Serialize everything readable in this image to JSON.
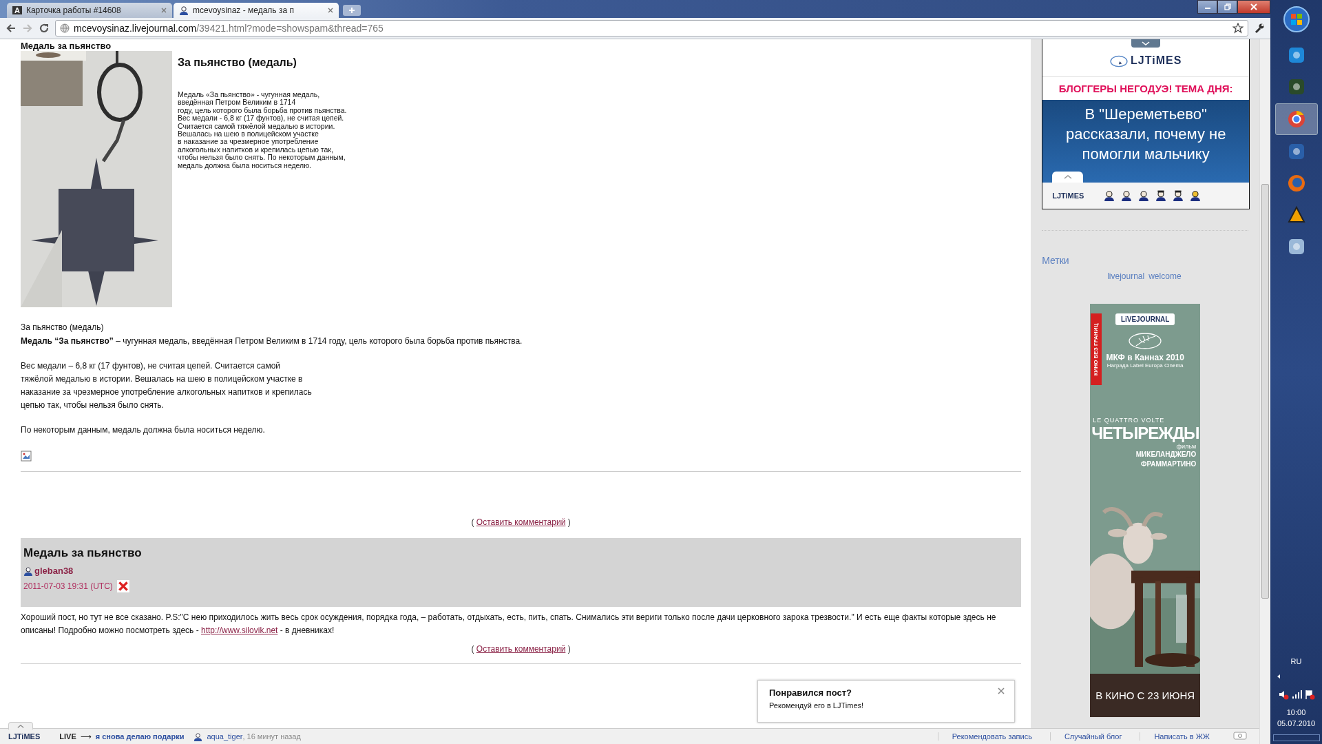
{
  "browser": {
    "tabs": [
      {
        "title": "Карточка работы #14608",
        "icon_letter": "A",
        "selected": false
      },
      {
        "title": "mcevoysinaz - медаль за п",
        "selected": true
      }
    ],
    "url": {
      "host": "mcevoysinaz.livejournal.com",
      "path": "/39421.html?mode=showspam&thread=765"
    }
  },
  "post": {
    "title": "Медаль за пьянство",
    "figure": {
      "heading": "За пьянство (медаль)",
      "lines": [
        "Медаль «За пьянство» - чугунная медаль,",
        "введённая Петром Великим в 1714",
        "году, цель которого была борьба против пьянства.",
        "Вес медали - 6,8 кг (17 фунтов), не считая цепей.",
        "Считается самой тяжёлой медалью в истории.",
        "Вешалась на шею в полицейском участке",
        "в наказание за чрезмерное употребление",
        "алкогольных напитков и крепилась цепью так,",
        "чтобы нельзя было снять. По некоторым данным,",
        "медаль должна была носиться неделю."
      ]
    },
    "caption": "За пьянство (медаль)",
    "lead": "**Медаль “За пьянство”** – чугунная медаль, введённая Петром Великим в 1714 году, цель которого была борьба против пьянства.",
    "paragraph_lines": [
      "Вес медали – 6,8 кг (17 фунтов), не считая цепей. Считается самой",
      "тяжёлой медалью в истории. Вешалась на шею в полицейском участке в",
      "наказание за чрезмерное употребление алкогольных напитков и крепилась",
      "цепью так, чтобы нельзя было снять."
    ],
    "closing": "По некоторым данным, медаль должна была носиться неделю.",
    "comment_link": {
      "before": "(",
      "label": "Оставить комментарий",
      "after": ")"
    }
  },
  "comment": {
    "title": "Медаль за пьянство",
    "user": "gleban38",
    "date": "2011-07-03 19:31 (UTC)",
    "text": "Хороший пост, но тут не все сказано. P.S:\"С нею приходилось жить весь срок осуждения, порядка года, – работать, отдыхать, есть, пить, спать. Снимались эти вериги только после дачи церковного зарока трезвости.\" И есть еще факты которые здесь не описаны! Подробно можно посмотреть здесь -",
    "link": "http://www.silovik.net",
    "text_after": "- в дневниках!",
    "reply_link": {
      "before": "(",
      "label": "Оставить комментарий",
      "after": ")"
    }
  },
  "popup": {
    "title": "Понравился пост?",
    "text": "Рекомендуй его в LJTimes!"
  },
  "sidebar": {
    "widget": {
      "logo": "LJTiMES",
      "kicker": "БЛОГГЕРЫ НЕГОДУЭ! ТЕМА ДНЯ:",
      "headline": "В \"Шереметьево\" рассказали, почему не помогли мальчику",
      "footer_logo": "LJTiMES"
    },
    "tags_title": "Метки",
    "tags": [
      "livejournal",
      "welcome"
    ],
    "ad": {
      "side_label": "КИНО БЕЗ ГРАНИЦ",
      "logo": "LiVEJOURNAL",
      "festival": "МКФ в Каннах 2010",
      "award": "Награда Label Europa Cinema",
      "original_title": "LE QUATTRO VOLTE",
      "title": "ЧЕТЫРЕЖДЫ",
      "film_label": "фильм",
      "director_lines": [
        "МИКЕЛАНДЖЕЛО",
        "ФРАММАРТИНО"
      ],
      "release": "В КИНО С 23 ИЮНЯ"
    }
  },
  "lj_bar": {
    "logo": "LJTiMES",
    "live": "LIVE",
    "arrow": "⟶",
    "live_link": "я снова делаю подарки",
    "user": "aqua_tiger",
    "time": ", 16 минут назад",
    "links": [
      "Рекомендовать запись",
      "Случайный блог",
      "Написать в ЖЖ"
    ]
  },
  "taskbar": {
    "language": "RU",
    "time": "10:00",
    "date": "05.07.2010"
  }
}
